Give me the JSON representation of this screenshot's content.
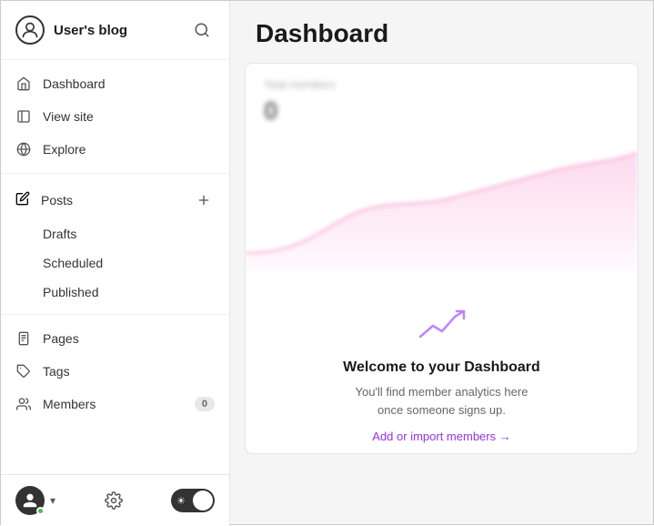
{
  "sidebar": {
    "blog_title": "User's blog",
    "nav_items": [
      {
        "id": "dashboard",
        "label": "Dashboard",
        "icon": "home"
      },
      {
        "id": "view-site",
        "label": "View site",
        "icon": "external"
      },
      {
        "id": "explore",
        "label": "Explore",
        "icon": "globe"
      }
    ],
    "posts_label": "Posts",
    "posts_sub_items": [
      {
        "id": "drafts",
        "label": "Drafts"
      },
      {
        "id": "scheduled",
        "label": "Scheduled"
      },
      {
        "id": "published",
        "label": "Published"
      }
    ],
    "other_nav_items": [
      {
        "id": "pages",
        "label": "Pages",
        "icon": "page"
      },
      {
        "id": "tags",
        "label": "Tags",
        "icon": "tag"
      },
      {
        "id": "members",
        "label": "Members",
        "icon": "members",
        "badge": "0"
      }
    ]
  },
  "main": {
    "title": "Dashboard",
    "card": {
      "total_members_label": "Total members",
      "total_members_value": "0",
      "empty_state_title": "Welcome to your Dashboard",
      "empty_state_desc": "You'll find member analytics here once someone signs up.",
      "empty_link": "Add or import members →"
    }
  }
}
